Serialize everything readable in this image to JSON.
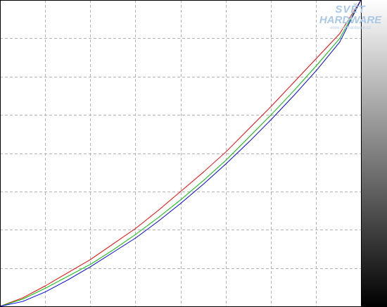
{
  "watermark": {
    "line1": "SVĚT",
    "line2": "HARDWARE",
    "line3": "www.svethardware.cz"
  },
  "chart_data": {
    "type": "line",
    "title": "",
    "xlabel": "",
    "ylabel": "",
    "xlim": [
      0,
      255
    ],
    "ylim": [
      0,
      255
    ],
    "grid": true,
    "grid_divisions_x": 8,
    "grid_divisions_y": 8,
    "legend": "none",
    "side_gradient": {
      "from": "#ffffff",
      "to": "#000000",
      "direction": "top-to-bottom"
    },
    "series": [
      {
        "color": "#ff0000",
        "x": [
          0,
          16,
          32,
          48,
          64,
          80,
          96,
          112,
          128,
          144,
          160,
          176,
          192,
          208,
          224,
          240,
          255
        ],
        "y": [
          0,
          7,
          17,
          28,
          39,
          52,
          65,
          80,
          96,
          112,
          129,
          148,
          167,
          187,
          207,
          227,
          255
        ]
      },
      {
        "color": "#00c000",
        "x": [
          0,
          16,
          32,
          48,
          64,
          80,
          96,
          112,
          128,
          144,
          160,
          176,
          192,
          208,
          224,
          240,
          255
        ],
        "y": [
          0,
          6,
          15,
          25,
          35,
          47,
          60,
          74,
          89,
          105,
          122,
          141,
          160,
          180,
          201,
          223,
          255
        ]
      },
      {
        "color": "#0000ff",
        "x": [
          0,
          16,
          32,
          48,
          64,
          80,
          96,
          112,
          128,
          144,
          160,
          176,
          192,
          208,
          224,
          240,
          255
        ],
        "y": [
          0,
          4,
          12,
          22,
          33,
          45,
          57,
          71,
          86,
          102,
          119,
          137,
          156,
          176,
          197,
          220,
          255
        ]
      }
    ]
  }
}
